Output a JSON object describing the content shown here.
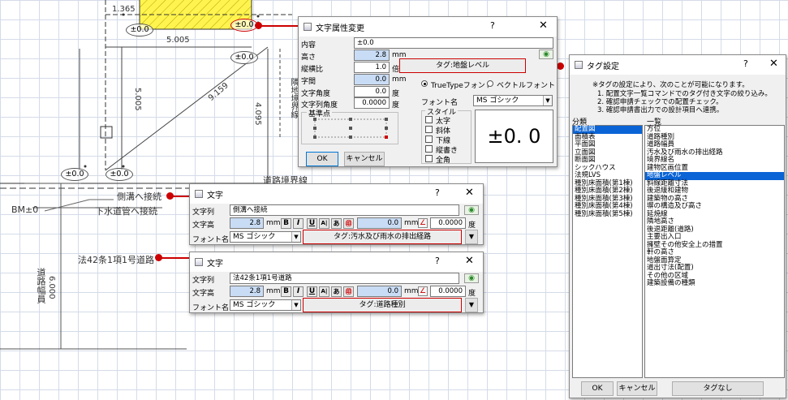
{
  "cad": {
    "dims": {
      "d1365": "1.365",
      "d5005h": "5.005",
      "d5005v": "5.005",
      "d9159": "9.159",
      "d4095": "4.095",
      "d6000": "6.000"
    },
    "elev_marks": {
      "top": "±0.0",
      "mid": "±0.0",
      "left": "±0.0",
      "left2": "±0.0",
      "left3": "±0.0"
    },
    "bm": "BM±0",
    "road_boundary": "道路境界線",
    "road_width": "道路幅員",
    "lower_sewer": "下水道管へ接続",
    "side_ditch": "側溝へ接続",
    "road_law": "法42条1項1号道路",
    "vertical_text": "隣地境界線"
  },
  "attr_dialog": {
    "title": "文字属性変更",
    "help": "?",
    "close": "✕",
    "content_label": "内容",
    "content_value": "±0.0",
    "height_label": "高さ",
    "height_value": "2.8",
    "height_unit": "mm",
    "aspect_label": "縦横比",
    "aspect_value": "1.0",
    "aspect_unit": "倍",
    "spacing_label": "字間",
    "spacing_value": "0.0",
    "spacing_unit": "mm",
    "char_angle_label": "文字角度",
    "char_angle_value": "0.0",
    "char_angle_unit": "度",
    "line_angle_label": "文字列角度",
    "line_angle_value": "0.0000",
    "line_angle_unit": "度",
    "basepoint_label": "基準点",
    "tag_button": "タグ:地盤レベル",
    "truetype": "TrueTypeフォント",
    "vector": "ベクトルフォント",
    "fontname_label": "フォント名",
    "fontname_value": "MS ゴシック",
    "style_label": "スタイル",
    "styles": [
      "太字",
      "斜体",
      "下線",
      "縦書き",
      "全角"
    ],
    "preview": "±0. 0",
    "ok": "OK",
    "cancel": "キャンセル"
  },
  "text_dialog_1": {
    "title": "文字",
    "help": "?",
    "close": "✕",
    "string_label": "文字列",
    "string_value": "側溝へ接続",
    "height_label": "文字高",
    "height_value": "2.8",
    "unit_mm": "mm",
    "second_value": "0.0",
    "angle_value": "0.0000",
    "angle_unit": "度",
    "fmt": [
      "B",
      "I",
      "U",
      "A|",
      "あ",
      "㊞"
    ],
    "font_label": "フォント名",
    "font_value": "MS ゴシック",
    "tag_button": "タグ:汚水及び雨水の排出経路",
    "expand": "▼"
  },
  "text_dialog_2": {
    "title": "文字",
    "help": "?",
    "close": "✕",
    "string_label": "文字列",
    "string_value": "法42条1項1号道路",
    "height_label": "文字高",
    "height_value": "2.8",
    "unit_mm": "mm",
    "second_value": "0.0",
    "angle_value": "0.0000",
    "angle_unit": "度",
    "fmt": [
      "B",
      "I",
      "U",
      "A|",
      "あ",
      "㊞"
    ],
    "font_label": "フォント名",
    "font_value": "MS ゴシック",
    "tag_button": "タグ:道路種別",
    "expand": "▼"
  },
  "tag_dialog": {
    "title": "タグ設定",
    "help": "?",
    "close": "✕",
    "desc_lines": [
      "※タグの設定により、次のことが可能になります。",
      "1. 配置文字一覧コマンドでのタグ付き文字の絞り込み。",
      "2. 確認申請チェックでの配置チェック。",
      "3. 確認申請書出力での設計項目へ連携。"
    ],
    "class_label": "分類",
    "list_label": "一覧",
    "classes": [
      "配置図",
      "面積表",
      "平面図",
      "立面図",
      "断面図",
      "シックハウス",
      "法規LVS",
      "種別床面積(第1棟)",
      "種別床面積(第2棟)",
      "種別床面積(第3棟)",
      "種別床面積(第4棟)",
      "種別床面積(第5棟)"
    ],
    "class_selected_index": 0,
    "items": [
      "方位",
      "道路種別",
      "道路幅員",
      "汚水及び雨水の排出経路",
      "境界線名",
      "建物区画位置",
      "地盤レベル",
      "斜線距離寸法",
      "後退緩和建物",
      "建築物の高さ",
      "塀の構造及び高さ",
      "延焼線",
      "隣地高さ",
      "後退距離(道路)",
      "主要出入口",
      "擁壁その他安全上の措置",
      "軒の高さ",
      "地盤面算定",
      "道出寸法(配置)",
      "その他の区域",
      "建築設備の種類"
    ],
    "item_selected_index": 6,
    "ok": "OK",
    "cancel": "キャンセル",
    "no_tag": "タグなし"
  },
  "colors": {
    "accent": "#cc0000",
    "selection": "#0a64d6",
    "input_blue": "#c9dcf5"
  }
}
